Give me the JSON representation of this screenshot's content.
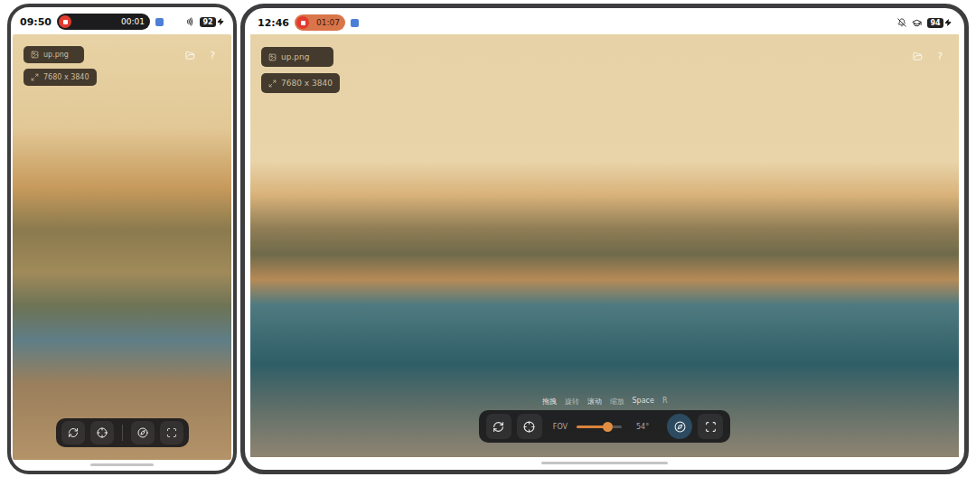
{
  "devices": [
    {
      "kind": "phone",
      "status_bar": {
        "time": "09:50",
        "recording": "00:01",
        "battery": "92"
      },
      "file": {
        "name": "up.png",
        "resolution": "7680 x 3840"
      },
      "help": "?",
      "hints": [],
      "toolbar": {
        "reset_active": false,
        "center_active": false,
        "fov": null,
        "compass_active": false,
        "fullscreen_active": false
      }
    },
    {
      "kind": "tablet",
      "status_bar": {
        "time": "12:46",
        "recording": "01:07",
        "battery": "94"
      },
      "file": {
        "name": "up.png",
        "resolution": "7680 x 3840"
      },
      "help": "?",
      "hints": [
        "拖拽",
        "旋转",
        "滚动",
        "缩放",
        "Space",
        "R"
      ],
      "toolbar": {
        "reset_active": false,
        "center_active": false,
        "fov": {
          "label": "FOV",
          "level": 0.68,
          "reading": "54°"
        },
        "compass_active": true,
        "fullscreen_active": false
      }
    }
  ]
}
